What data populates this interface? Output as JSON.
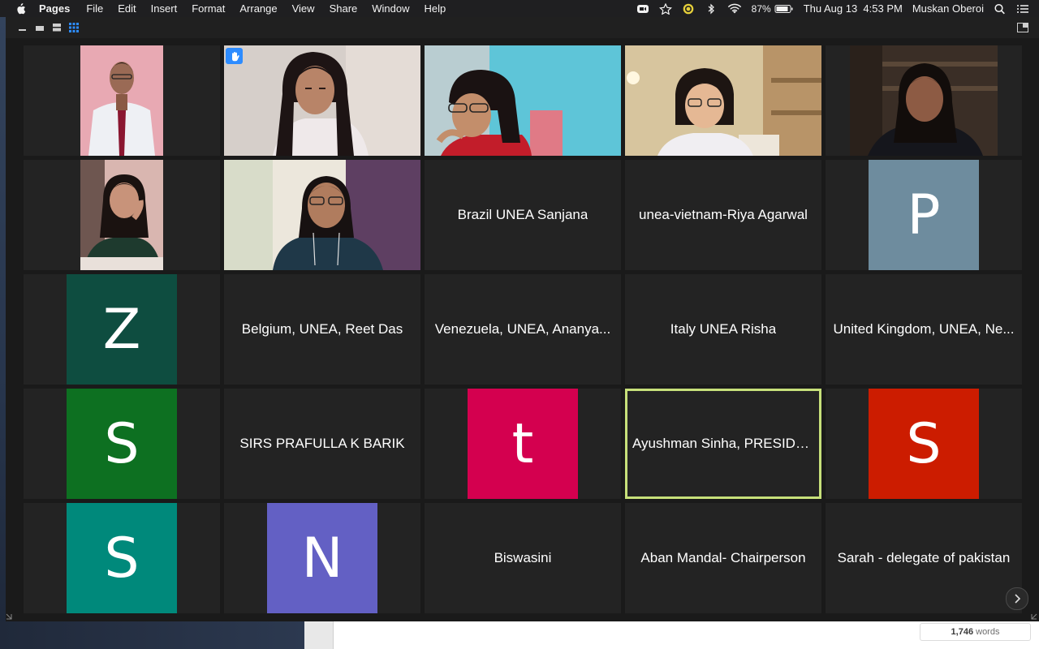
{
  "menubar": {
    "app": "Pages",
    "items": [
      "File",
      "Edit",
      "Insert",
      "Format",
      "Arrange",
      "View",
      "Share",
      "Window",
      "Help"
    ],
    "battery": "87%",
    "clock": "Thu Aug 13  4:53 PM",
    "user": "Muskan Oberoi",
    "icons": [
      "zoom-icon",
      "star-icon",
      "grammarly-icon",
      "bluetooth-icon",
      "wifi-icon",
      "battery-icon",
      "search-icon",
      "list-icon"
    ]
  },
  "tiles": [
    {
      "type": "video",
      "scene": "boy-tie"
    },
    {
      "type": "video",
      "scene": "girl-hair",
      "raised_hand": true
    },
    {
      "type": "video",
      "scene": "girl-glasses-blue"
    },
    {
      "type": "video",
      "scene": "girl-glasses-room"
    },
    {
      "type": "video",
      "scene": "girl-dark-room"
    },
    {
      "type": "video",
      "scene": "girl-pink-wall"
    },
    {
      "type": "video",
      "scene": "girl-glasses-curtain"
    },
    {
      "type": "name",
      "label": "Brazil UNEA Sanjana"
    },
    {
      "type": "name",
      "label": "unea-vietnam-Riya Agarwal"
    },
    {
      "type": "avatar",
      "letter": "P",
      "color": "#6e8c9e"
    },
    {
      "type": "avatar",
      "letter": "Z",
      "color": "#0e4d40"
    },
    {
      "type": "name",
      "label": "Belgium, UNEA, Reet Das"
    },
    {
      "type": "name",
      "label": "Venezuela, UNEA, Ananya..."
    },
    {
      "type": "name",
      "label": "Italy UNEA Risha"
    },
    {
      "type": "name",
      "label": "United Kingdom, UNEA, Ne..."
    },
    {
      "type": "avatar",
      "letter": "S",
      "color": "#0d7021"
    },
    {
      "type": "name",
      "label": "SIRS PRAFULLA K BARIK"
    },
    {
      "type": "avatar",
      "letter": "t",
      "color": "#d4004f"
    },
    {
      "type": "name",
      "label": "Ayushman Sinha, PRESIDE...",
      "active": true
    },
    {
      "type": "avatar",
      "letter": "S",
      "color": "#cc1c00"
    },
    {
      "type": "avatar",
      "letter": "S",
      "color": "#00897b"
    },
    {
      "type": "avatar",
      "letter": "N",
      "color": "#6360c4"
    },
    {
      "type": "name",
      "label": "Biswasini"
    },
    {
      "type": "name",
      "label": "Aban Mandal- Chairperson"
    },
    {
      "type": "name",
      "label": "Sarah - delegate of pakistan"
    }
  ],
  "pages": {
    "word_count": "1,746",
    "word_count_unit": "words"
  }
}
